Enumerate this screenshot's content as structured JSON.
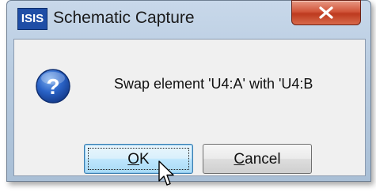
{
  "window": {
    "title": "Schematic Capture",
    "app_icon_text": "ISIS"
  },
  "dialog": {
    "message": "Swap element 'U4:A' with 'U4:B",
    "ok_label_mnemonic": "O",
    "ok_label_rest": "K",
    "cancel_label_mnemonic": "C",
    "cancel_label_rest": "ancel"
  },
  "icons": {
    "title_icon": "isis-app-icon",
    "close": "close-icon",
    "message_icon": "question-icon",
    "pointer": "mouse-pointer-icon"
  },
  "colors": {
    "close_button": "#d2563b",
    "question_icon": "#1f57b5",
    "focus_button": "#bee6fd"
  }
}
